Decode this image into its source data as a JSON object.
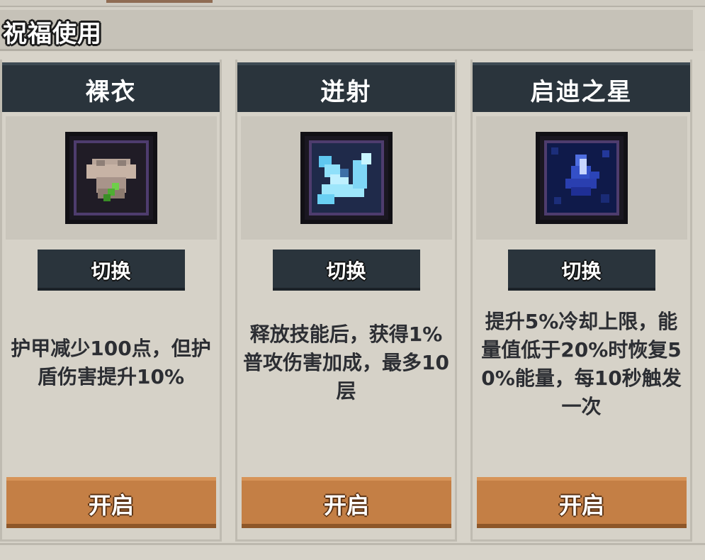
{
  "header": {
    "title": "祝福使用"
  },
  "cards": [
    {
      "name": "裸衣",
      "switch_label": "切换",
      "description": "护甲减少100点，但护盾伤害提升10%",
      "open_label": "开启",
      "icon": "naked-robe-icon"
    },
    {
      "name": "迸射",
      "switch_label": "切换",
      "description": "释放技能后，获得1%普攻伤害加成，最多10层",
      "open_label": "开启",
      "icon": "burst-shard-icon"
    },
    {
      "name": "启迪之星",
      "switch_label": "切换",
      "description": "提升5%冷却上限，能量值低于20%时恢复50%能量，每10秒触发一次",
      "open_label": "开启",
      "icon": "enlightenment-star-icon"
    }
  ],
  "colors": {
    "title_bar": "#2a343c",
    "open_button": "#c47f45",
    "icon_frame_border": "#4e3c6e",
    "description_text": "#2c2e33"
  }
}
